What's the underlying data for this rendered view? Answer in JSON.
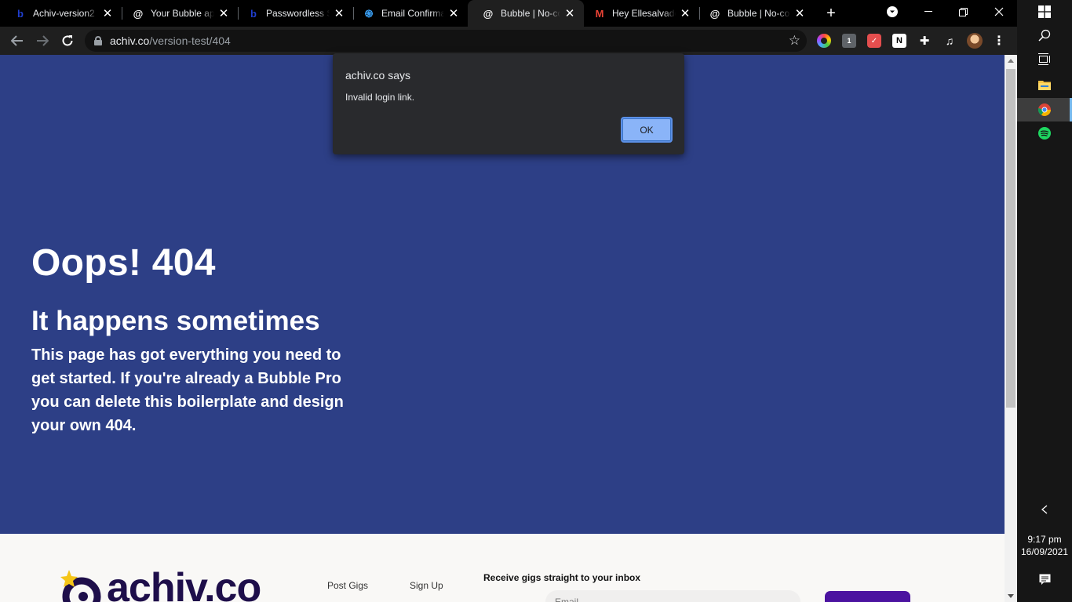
{
  "browser": {
    "tabs": [
      {
        "title": "Achiv-version2",
        "favicon": "b",
        "favicon_color": "#1f3ecf",
        "active": false
      },
      {
        "title": "Your Bubble app",
        "favicon": "@",
        "favicon_color": "#ffffff",
        "active": false
      },
      {
        "title": "Passwordless Sign",
        "favicon": "b",
        "favicon_color": "#1f3ecf",
        "active": false
      },
      {
        "title": "Email Confirmati",
        "favicon": "⟳",
        "favicon_color": "#3aa0f5",
        "active": false
      },
      {
        "title": "Bubble | No-cod",
        "favicon": "@",
        "favicon_color": "#ffffff",
        "active": true
      },
      {
        "title": "Hey Ellesalvador",
        "favicon": "M",
        "favicon_color": "#ea4335",
        "active": false
      },
      {
        "title": "Bubble | No-cod",
        "favicon": "@",
        "favicon_color": "#ffffff",
        "active": false
      }
    ],
    "new_tab": "+",
    "url_host": "achiv.co",
    "url_path": "/version-test/404"
  },
  "page": {
    "heading": "Oops! 404",
    "subheading": "It happens sometimes",
    "body": "This page has got everything you need to get started. If you're already a Bubble Pro you can delete this boilerplate and design your own 404.",
    "colors": {
      "hero_bg": "#2d3f86",
      "footer_bg": "#f9f8f6",
      "brand_dark": "#1e0e4a",
      "brand_purple": "#4b13a0",
      "star": "#f5c518"
    }
  },
  "footer": {
    "logo_text": "achiv.co",
    "links": [
      "Post Gigs",
      "Sign Up"
    ],
    "newsletter_label": "Receive gigs straight to your inbox",
    "email_placeholder": "Email"
  },
  "dialog": {
    "title": "achiv.co says",
    "message": "Invalid login link.",
    "ok_label": "OK"
  },
  "taskbar": {
    "time": "9:17 pm",
    "date": "16/09/2021"
  }
}
